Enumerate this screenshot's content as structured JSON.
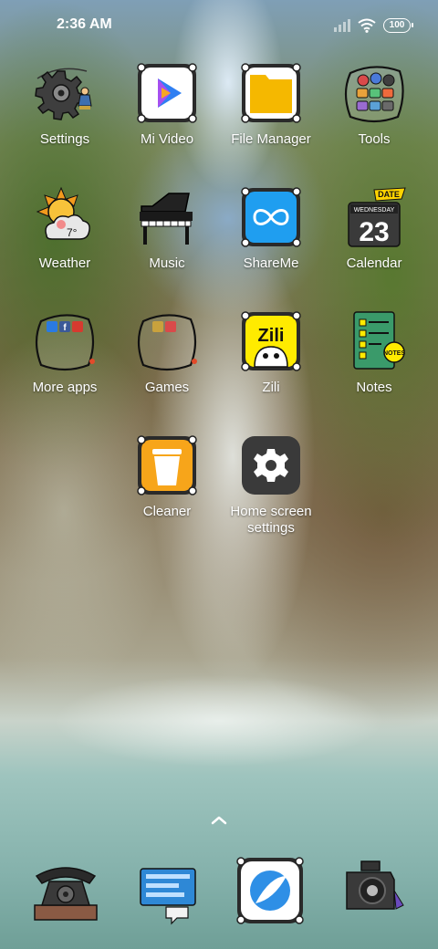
{
  "status_bar": {
    "time": "2:36 AM",
    "battery": "100",
    "icons": [
      "signal-icon",
      "wifi-icon",
      "battery-icon"
    ]
  },
  "apps": [
    {
      "label": "Settings",
      "icon": "gear-icon"
    },
    {
      "label": "Mi Video",
      "icon": "play-icon"
    },
    {
      "label": "File Manager",
      "icon": "folder-icon"
    },
    {
      "label": "Tools",
      "icon": "tools-folder-icon"
    },
    {
      "label": "Weather",
      "icon": "weather-icon",
      "temp": "7°"
    },
    {
      "label": "Music",
      "icon": "piano-icon"
    },
    {
      "label": "ShareMe",
      "icon": "infinity-icon"
    },
    {
      "label": "Calendar",
      "icon": "calendar-icon",
      "day": "WEDNESDAY",
      "date": "23",
      "badge": "DATE"
    },
    {
      "label": "More apps",
      "icon": "folder-icon"
    },
    {
      "label": "Games",
      "icon": "folder-icon"
    },
    {
      "label": "Zili",
      "icon": "zili-icon",
      "logo": "Zili"
    },
    {
      "label": "Notes",
      "icon": "notes-icon",
      "tag": "NOTES"
    },
    {
      "label": "Cleaner",
      "icon": "trash-icon"
    },
    {
      "label": "Home screen settings",
      "icon": "gear-icon"
    }
  ],
  "dock": [
    {
      "name": "phone",
      "icon": "telephone-icon"
    },
    {
      "name": "messaging",
      "icon": "chat-icon"
    },
    {
      "name": "browser",
      "icon": "planet-icon"
    },
    {
      "name": "camera",
      "icon": "camera-icon"
    }
  ],
  "drawer_indicator": "chevron-up-icon",
  "colors": {
    "file_manager": "#f5b800",
    "shareme": "#1f9ef0",
    "zili": "#ffeb00",
    "notes": "#3a9a6a",
    "cleaner": "#f7a51a",
    "home_settings_bg": "#3a3a3a",
    "browser": "#2e8fe6"
  }
}
